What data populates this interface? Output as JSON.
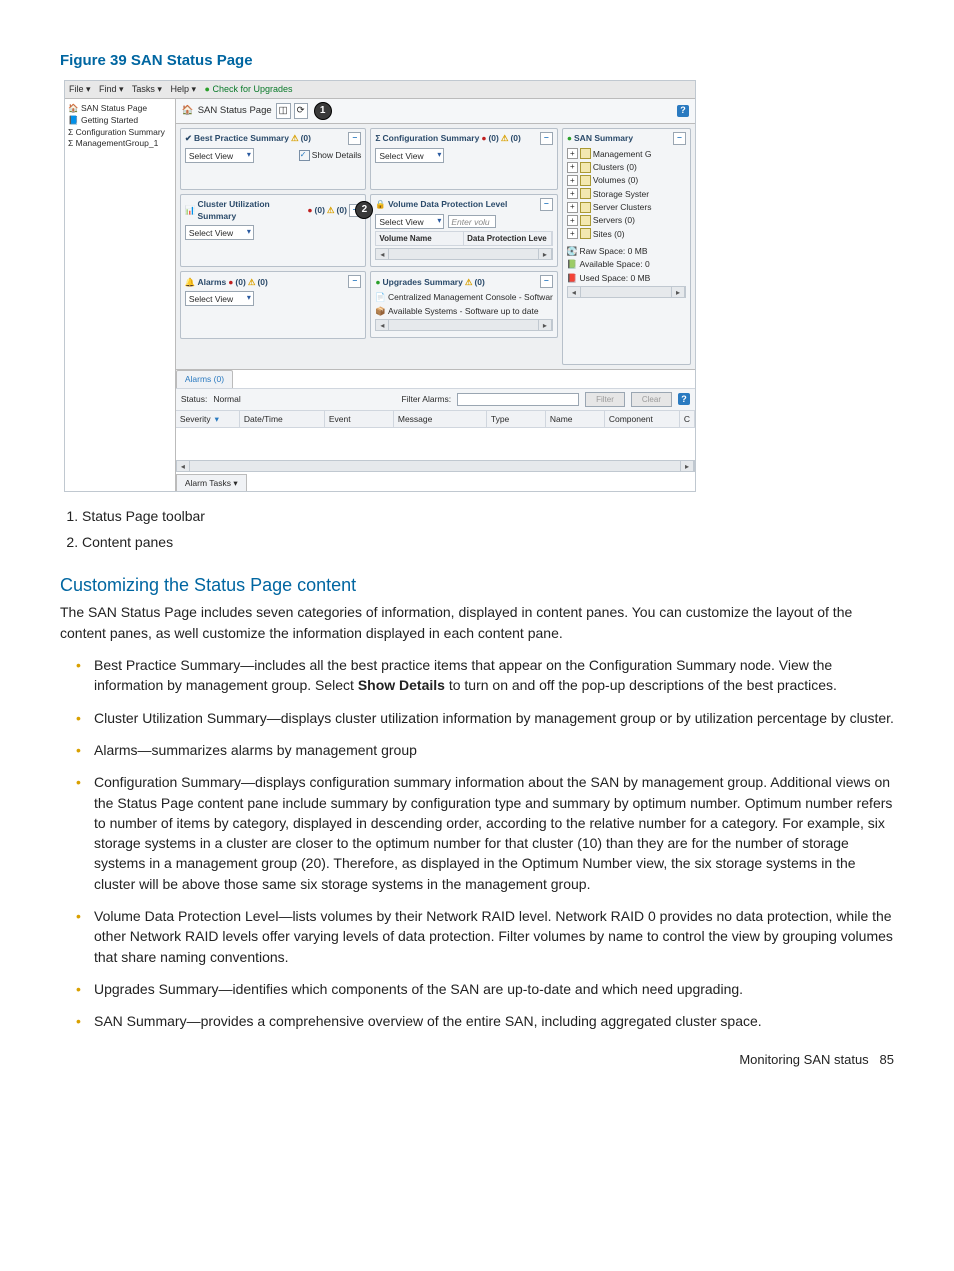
{
  "figure": {
    "label": "Figure 39 SAN Status Page"
  },
  "menubar": {
    "items": [
      "File ▾",
      "Find ▾",
      "Tasks ▾",
      "Help ▾"
    ],
    "upgrade": "Check for Upgrades"
  },
  "navtree": {
    "items": [
      "SAN Status Page",
      "Getting Started",
      "Configuration Summary",
      "ManagementGroup_1"
    ]
  },
  "tabbar": {
    "title": "SAN Status Page",
    "help": "?"
  },
  "callouts": {
    "one": "1",
    "two": "2"
  },
  "panes": {
    "best": {
      "title": "Best Practice Summary",
      "count": "(0)",
      "select": "Select View",
      "show_details": "Show Details"
    },
    "config": {
      "title": "Configuration Summary",
      "r": "(0)",
      "y": "(0)",
      "select": "Select View"
    },
    "summary": {
      "title": "SAN Summary",
      "tree": [
        "Management G",
        "Clusters (0)",
        "Volumes (0)",
        "Storage Syster",
        "Server Clusters",
        "Servers (0)",
        "Sites (0)"
      ],
      "raw": "Raw Space: 0 MB",
      "avail": "Available Space: 0",
      "used": "Used Space: 0 MB"
    },
    "cluster": {
      "title": "Cluster Utilization Summary",
      "r": "(0)",
      "y": "(0)",
      "select": "Select View"
    },
    "vdpl": {
      "title": "Volume Data Protection Level",
      "select": "Select View",
      "filter_ph": "Enter volu",
      "col1": "Volume Name",
      "col2": "Data Protection Leve"
    },
    "alarms_pane": {
      "title": "Alarms",
      "r": "(0)",
      "y": "(0)",
      "select": "Select View"
    },
    "upgrades": {
      "title": "Upgrades Summary",
      "y": "(0)",
      "line1": "Centralized Management Console - Softwar",
      "line2": "Available Systems - Software up to date"
    }
  },
  "alarms_panel": {
    "tab": "Alarms (0)",
    "status_label": "Status:",
    "status_value": "Normal",
    "filter_label": "Filter Alarms:",
    "btn_filter": "Filter",
    "btn_clear": "Clear",
    "help": "?",
    "cols": [
      "Severity",
      "Date/Time",
      "Event",
      "Message",
      "Type",
      "Name",
      "Component",
      "C"
    ],
    "bot_btn": "Alarm Tasks ▾"
  },
  "caption": {
    "item1": "Status Page toolbar",
    "item2": "Content panes"
  },
  "section": {
    "title": "Customizing the Status Page content"
  },
  "para1": "The SAN Status Page includes seven categories of information, displayed in content panes. You can customize the layout of the content panes, as well customize the information displayed in each content pane.",
  "bullets": {
    "b1a": "Best Practice Summary—includes all the best practice items that appear on the Configuration Summary node. View the information by management group. Select ",
    "b1b": "Show Details",
    "b1c": " to turn on and off the pop-up descriptions of the best practices.",
    "b2": "Cluster Utilization Summary—displays cluster utilization information by management group or by utilization percentage by cluster.",
    "b3": "Alarms—summarizes alarms by management group",
    "b4": "Configuration Summary—displays configuration summary information about the SAN by management group. Additional views on the Status Page content pane include summary by configuration type and summary by optimum number. Optimum number refers to number of items by category, displayed in descending order, according to the relative number for a category. For example, six storage systems in a cluster are closer to the optimum number for that cluster (10) than they are for the number of storage systems in a management group (20). Therefore, as displayed in the Optimum Number view, the six storage systems in the cluster will be above those same six storage systems in the management group.",
    "b5": "Volume Data Protection Level—lists volumes by their Network RAID level. Network RAID 0 provides no data protection, while the other Network RAID levels offer varying levels of data protection. Filter volumes by name to control the view by grouping volumes that share naming conventions.",
    "b6": "Upgrades Summary—identifies which components of the SAN are up-to-date and which need upgrading.",
    "b7": "SAN Summary—provides a comprehensive overview of the entire SAN, including aggregated cluster space."
  },
  "footer": {
    "text": "Monitoring SAN status",
    "page": "85"
  }
}
